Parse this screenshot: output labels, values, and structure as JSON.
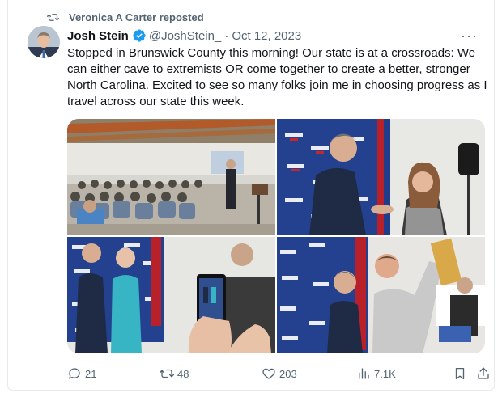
{
  "repost_banner": {
    "text": "Veronica A Carter reposted",
    "icon": "repost-icon"
  },
  "author": {
    "name": "Josh Stein",
    "handle": "@JoshStein_",
    "separator": "·",
    "date": "Oct 12, 2023",
    "verified_color": "#1d9bf0"
  },
  "tweet": {
    "text": "Stopped in Brunswick County this morning! Our state is at a crossroads: We can either cave to extremists OR come together to create a better, stronger North Carolina. Excited to see so many folks join me in choosing progress as I travel across our state this week."
  },
  "menu_label": "···",
  "actions": {
    "replies": "21",
    "reposts": "48",
    "likes": "203",
    "views": "7.1K"
  },
  "colors": {
    "muted": "#536471",
    "text": "#0f1419",
    "accent": "#1d9bf0",
    "backdrop_blue": "#23418f"
  }
}
